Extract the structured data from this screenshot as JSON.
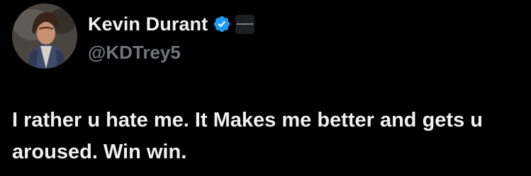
{
  "author": {
    "display_name": "Kevin Durant",
    "handle": "@KDTrey5",
    "verified": true,
    "verified_color": "#1d9bf0",
    "affiliate_badge_text": "BOARDROOM",
    "avatar_icon": "profile-avatar"
  },
  "tweet": {
    "text": "I rather u hate me. It Makes me better and gets u aroused. Win win."
  },
  "colors": {
    "background": "#000000",
    "text": "#e7e9ea",
    "secondary_text": "#71767b"
  }
}
